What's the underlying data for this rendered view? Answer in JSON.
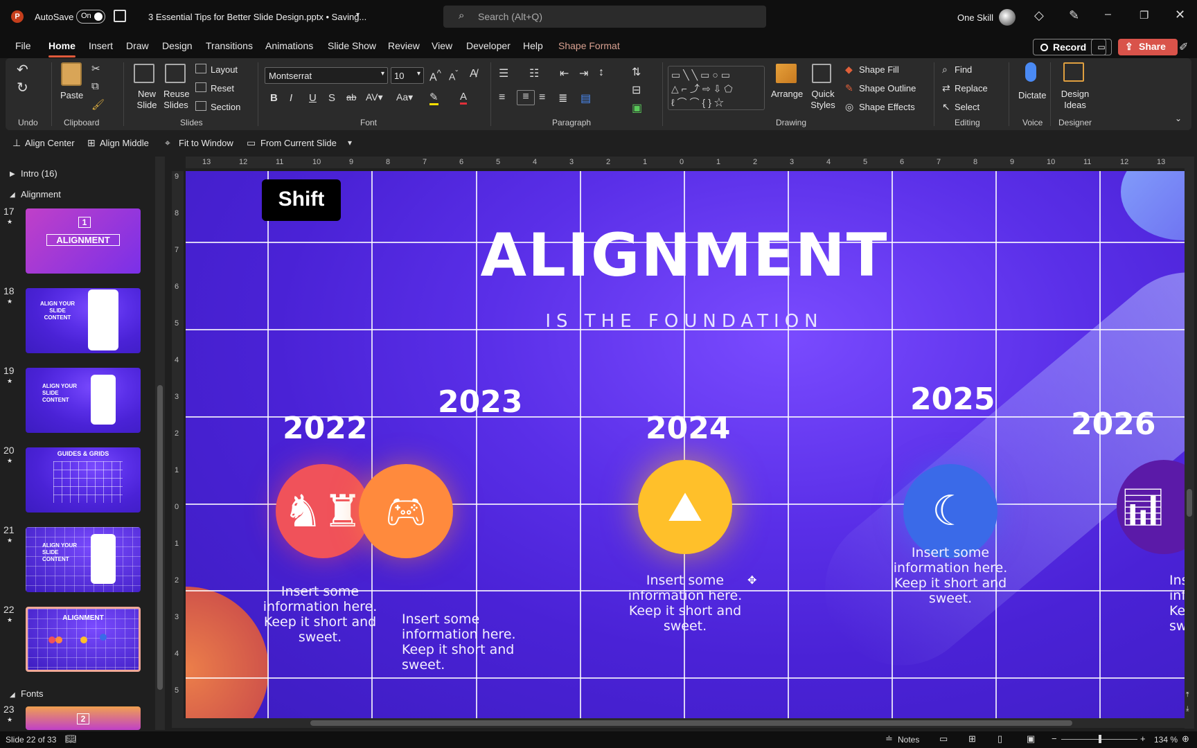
{
  "titlebar": {
    "autosave_label": "AutoSave",
    "autosave_state": "On",
    "doc_title": "3 Essential Tips for Better Slide Design.pptx • Saving...",
    "search_placeholder": "Search (Alt+Q)",
    "user_name": "One Skill"
  },
  "menu": {
    "items": [
      "File",
      "Home",
      "Insert",
      "Draw",
      "Design",
      "Transitions",
      "Animations",
      "Slide Show",
      "Review",
      "View",
      "Developer",
      "Help",
      "Shape Format"
    ],
    "record": "Record",
    "share": "Share"
  },
  "ribbon": {
    "groups": [
      "Undo",
      "Clipboard",
      "Slides",
      "Font",
      "Paragraph",
      "Drawing",
      "Editing",
      "Voice",
      "Designer"
    ],
    "paste": "Paste",
    "new_slide": "New Slide",
    "reuse_slides": "Reuse Slides",
    "layout": "Layout",
    "reset": "Reset",
    "section": "Section",
    "font_name": "Montserrat",
    "font_size": "10",
    "arrange": "Arrange",
    "quick_styles": "Quick Styles",
    "shape_fill": "Shape Fill",
    "shape_outline": "Shape Outline",
    "shape_effects": "Shape Effects",
    "find": "Find",
    "replace": "Replace",
    "select": "Select",
    "dictate": "Dictate",
    "design_ideas": "Design Ideas"
  },
  "qat": {
    "items": [
      "Align Center",
      "Align Middle",
      "Fit to Window",
      "From Current Slide"
    ]
  },
  "sections": {
    "intro": "Intro (16)",
    "alignment": "Alignment",
    "fonts": "Fonts"
  },
  "thumbnails": [
    {
      "num": "17",
      "text": "ALIGNMENT",
      "badge": "1"
    },
    {
      "num": "18",
      "text": "ALIGN YOUR SLIDE CONTENT"
    },
    {
      "num": "19",
      "text": "ALIGN YOUR SLIDE CONTENT"
    },
    {
      "num": "20",
      "text": "GUIDES & GRIDS"
    },
    {
      "num": "21",
      "text": "ALIGN YOUR SLIDE CONTENT"
    },
    {
      "num": "22",
      "text": "ALIGNMENT"
    },
    {
      "num": "23",
      "badge": "2"
    }
  ],
  "slide": {
    "shift_label": "Shift",
    "title": "ALIGNMENT",
    "subtitle": "IS THE FOUNDATION",
    "years": [
      "2022",
      "2023",
      "2024",
      "2025",
      "2026"
    ],
    "info_text": "Insert some information here. Keep it short and sweet.",
    "info_partial": "Ins inf Ke sw",
    "colors": {
      "red": "#f0525a",
      "orange": "#ff8a3d",
      "yellow": "#ffc02a",
      "blue": "#3a6ae8",
      "purple": "#5b1aa8"
    }
  },
  "ruler_h": [
    "13",
    "12",
    "11",
    "10",
    "9",
    "8",
    "7",
    "6",
    "5",
    "4",
    "3",
    "2",
    "1",
    "0",
    "1",
    "2",
    "3",
    "4",
    "5",
    "6",
    "7",
    "8",
    "9",
    "10",
    "11",
    "12",
    "13"
  ],
  "ruler_v": [
    "9",
    "8",
    "7",
    "6",
    "5",
    "4",
    "3",
    "2",
    "1",
    "0",
    "1",
    "2",
    "3",
    "4",
    "5"
  ],
  "status": {
    "slide_info": "Slide 22 of 33",
    "notes": "Notes",
    "zoom": "134 %"
  }
}
